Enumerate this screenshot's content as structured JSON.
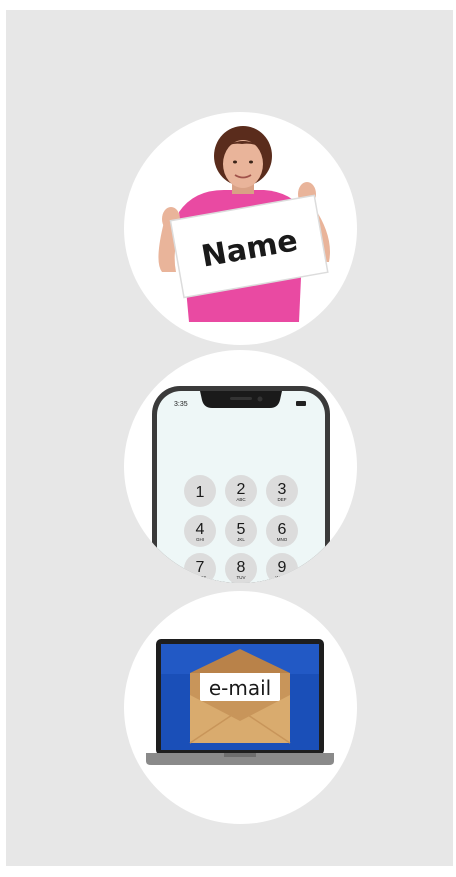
{
  "items": [
    {
      "icon": "person-holding-name-sign-icon",
      "sign_text": "Name"
    },
    {
      "icon": "smartphone-keypad-icon",
      "status_time": "3:35",
      "keys": [
        {
          "digit": "1",
          "letters": ""
        },
        {
          "digit": "2",
          "letters": "ABC"
        },
        {
          "digit": "3",
          "letters": "DEF"
        },
        {
          "digit": "4",
          "letters": "GHI"
        },
        {
          "digit": "5",
          "letters": "JKL"
        },
        {
          "digit": "6",
          "letters": "MNO"
        },
        {
          "digit": "7",
          "letters": "PQRS"
        },
        {
          "digit": "8",
          "letters": "TUV"
        },
        {
          "digit": "9",
          "letters": "WXYZ"
        }
      ]
    },
    {
      "icon": "laptop-email-envelope-icon",
      "label": "e-mail"
    }
  ],
  "colors": {
    "panel": "#e7e7e7",
    "circle": "#ffffff",
    "shirt": "#e94aa2",
    "hair": "#5a2c1c",
    "skin": "#e9b49a",
    "screen_blue": "#1a4fb8",
    "envelope": "#d9ab6e"
  }
}
